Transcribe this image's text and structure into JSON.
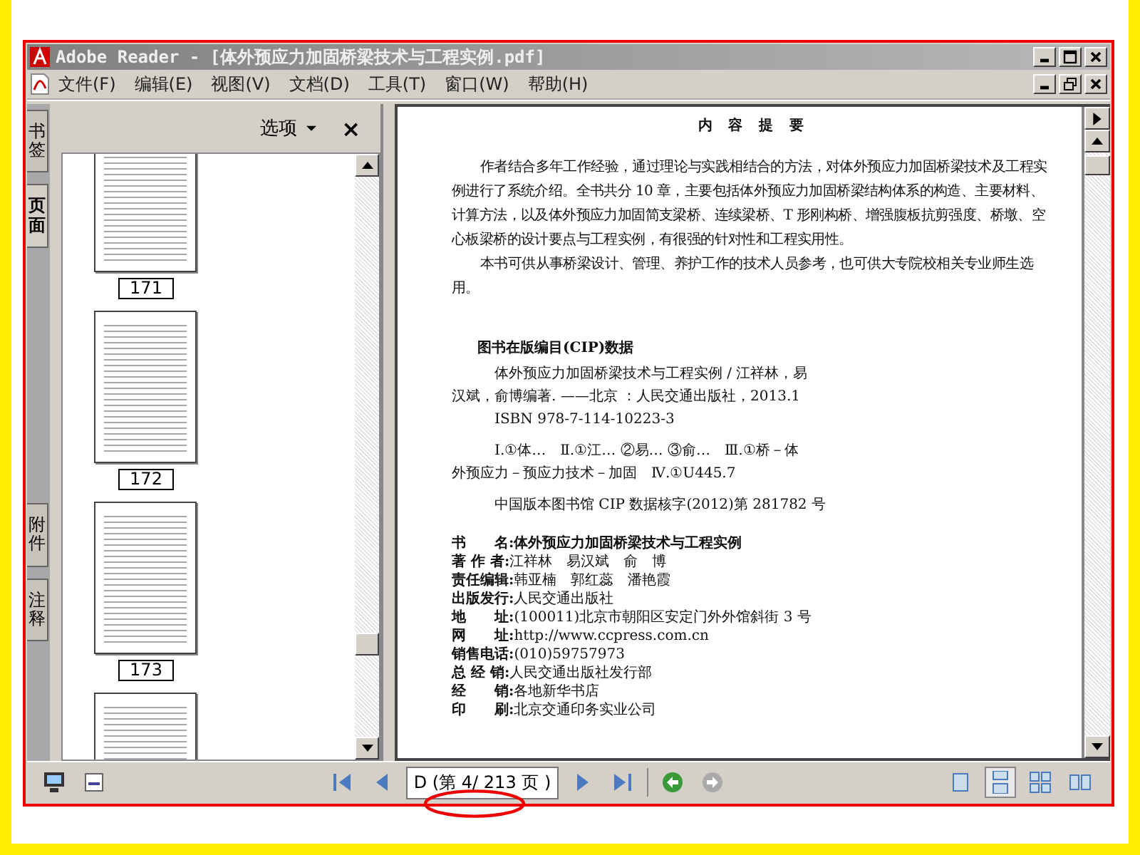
{
  "window": {
    "title": "Adobe Reader - [体外预应力加固桥梁技术与工程实例.pdf]"
  },
  "menu": [
    {
      "label": "文件(F)"
    },
    {
      "label": "编辑(E)"
    },
    {
      "label": "视图(V)"
    },
    {
      "label": "文档(D)"
    },
    {
      "label": "工具(T)"
    },
    {
      "label": "窗口(W)"
    },
    {
      "label": "帮助(H)"
    }
  ],
  "side_tabs_top": [
    {
      "label": "书签",
      "selected": false
    },
    {
      "label": "页面",
      "selected": true
    }
  ],
  "side_tabs_bottom": [
    {
      "label": "附件",
      "selected": false
    },
    {
      "label": "注释",
      "selected": false
    }
  ],
  "panel": {
    "options_label": "选项",
    "close": "×"
  },
  "thumbnails": [
    {
      "kind": "full",
      "label": "171"
    },
    {
      "kind": "full",
      "label": "172"
    },
    {
      "kind": "full",
      "label": "173"
    },
    {
      "kind": "partial"
    }
  ],
  "document": {
    "heading": "内 容 提 要",
    "summary": [
      "作者结合多年工作经验，通过理论与实践相结合的方法，对体外预应力加固桥梁技术及工程实例进行了系统介绍。全书共分 10 章，主要包括体外预应力加固桥梁结构体系的构造、主要材料、计算方法，以及体外预应力加固简支梁桥、连续梁桥、T 形刚构桥、增强腹板抗剪强度、桥墩、空心板梁桥的设计要点与工程实例，有很强的针对性和工程实用性。",
      "本书可供从事桥梁设计、管理、养护工作的技术人员参考，也可供大专院校相关专业师生选用。"
    ],
    "cip_title": "图书在版编目(CIP)数据",
    "cip_lines": [
      {
        "text": "体外预应力加固桥梁技术与工程实例 / 江祥林，易",
        "indent": true
      },
      {
        "text": "汉斌，俞博编著. ——北京 ：人民交通出版社，2013.1",
        "indent": false
      },
      {
        "text": "ISBN 978-7-114-10223-3",
        "indent": true
      },
      {
        "text": "Ⅰ.①体…　Ⅱ.①江… ②易… ③俞…　Ⅲ.①桥－体",
        "indent": true
      },
      {
        "text": "外预应力－预应力技术－加固　Ⅳ.①U445.7",
        "indent": false
      },
      {
        "text": "中国版本图书馆 CIP 数据核字(2012)第 281782 号",
        "indent": true
      }
    ],
    "credits": [
      {
        "label": "书　　名:",
        "value": "体外预应力加固桥梁技术与工程实例",
        "bold": true
      },
      {
        "label": "著 作 者:",
        "value": "江祥林　易汉斌　俞　博",
        "bold": false
      },
      {
        "label": "责任编辑:",
        "value": "韩亚楠　郭红蕊　潘艳霞",
        "bold": false
      },
      {
        "label": "出版发行:",
        "value": "人民交通出版社",
        "bold": false
      },
      {
        "label": "地　　址:",
        "value": "(100011)北京市朝阳区安定门外外馆斜街 3 号",
        "bold": false
      },
      {
        "label": "网　　址:",
        "value": "http://www.ccpress.com.cn",
        "bold": false
      },
      {
        "label": "销售电话:",
        "value": "(010)59757973",
        "bold": false
      },
      {
        "label": "总 经 销:",
        "value": "人民交通出版社发行部",
        "bold": false
      },
      {
        "label": "经　　销:",
        "value": "各地新华书店",
        "bold": false
      },
      {
        "label": "印　　刷:",
        "value": "北京交通印务实业公司",
        "bold": false
      }
    ]
  },
  "toolbar": {
    "page_field": "D (第 4/ 213 页 )",
    "views": [
      {
        "kind": "single",
        "selected": false
      },
      {
        "kind": "continuous",
        "selected": true
      },
      {
        "kind": "continuous-facing",
        "selected": false
      },
      {
        "kind": "facing",
        "selected": false
      }
    ]
  }
}
